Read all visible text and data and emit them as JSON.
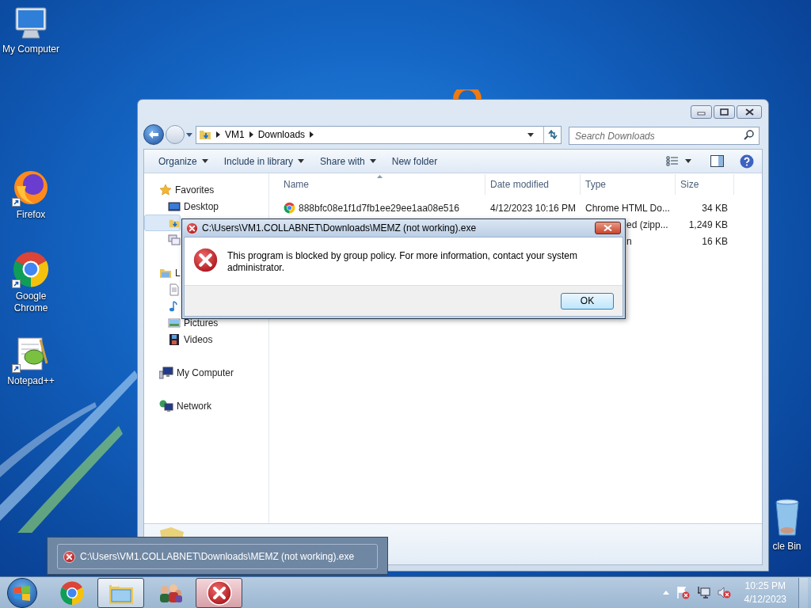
{
  "desktop_icons": [
    {
      "label": "My Computer",
      "kind": "computer"
    },
    {
      "label": "Firefox",
      "kind": "firefox"
    },
    {
      "label": "Google Chrome",
      "kind": "chrome"
    },
    {
      "label": "Notepad++",
      "kind": "notepad"
    },
    {
      "label": "cle Bin",
      "kind": "recycle"
    }
  ],
  "explorer": {
    "breadcrumb": [
      "VM1",
      "Downloads"
    ],
    "search": {
      "placeholder": "Search Downloads"
    },
    "toolbar": [
      {
        "label": "Organize",
        "menu": true
      },
      {
        "label": "Include in library",
        "menu": true
      },
      {
        "label": "Share with",
        "menu": true
      },
      {
        "label": "New folder",
        "menu": false
      }
    ],
    "nav": [
      {
        "label": "Favorites",
        "kind": "star",
        "selected": false,
        "children": [
          {
            "label": "Desktop",
            "kind": "desktop",
            "selected": false
          },
          {
            "kind": "downloads",
            "selected": true
          },
          {
            "kind": "places",
            "selected": false
          }
        ]
      },
      {
        "label": "L",
        "kind": "library",
        "selected": false,
        "children": [
          {
            "kind": "documents",
            "selected": false
          },
          {
            "kind": "music",
            "selected": false
          },
          {
            "label": "Pictures",
            "kind": "pictures",
            "selected": false
          },
          {
            "label": "Videos",
            "kind": "videos",
            "selected": false
          }
        ]
      },
      {
        "label": "My Computer",
        "kind": "computer",
        "selected": false
      },
      {
        "label": "Network",
        "kind": "network",
        "selected": false
      }
    ],
    "columns": [
      {
        "label": "Name",
        "sorted": true
      },
      {
        "label": "Date modified",
        "sorted": false
      },
      {
        "label": "Type",
        "sorted": false
      },
      {
        "label": "Size",
        "sorted": false
      }
    ],
    "rows": [
      {
        "kind": "chrome",
        "name": "888bfc08e1f1d7fb1ee29ee1aa08e516",
        "date": "4/12/2023 10:16 PM",
        "type": "Chrome HTML Do...",
        "size": "34 KB",
        "type_cut": false
      },
      {
        "type": "ed (zipp...",
        "size": "1,249 KB",
        "type_cut": true
      },
      {
        "type": "n",
        "size": "16 KB",
        "type_cut": true
      }
    ]
  },
  "dialog": {
    "title": "C:\\Users\\VM1.COLLABNET\\Downloads\\MEMZ (not working).exe",
    "message": "This program is blocked by group policy. For more information, contact your system administrator.",
    "buttons": [
      "OK"
    ]
  },
  "tooltip": {
    "title": "C:\\Users\\VM1.COLLABNET\\Downloads\\MEMZ (not working).exe"
  },
  "taskbar": {
    "items": [
      {
        "kind": "chrome",
        "active": false
      },
      {
        "kind": "explorer",
        "active": true
      },
      {
        "kind": "people",
        "active": false
      },
      {
        "kind": "error",
        "active": true
      }
    ],
    "clock": {
      "time": "10:25 PM",
      "date": "4/12/2023"
    }
  }
}
